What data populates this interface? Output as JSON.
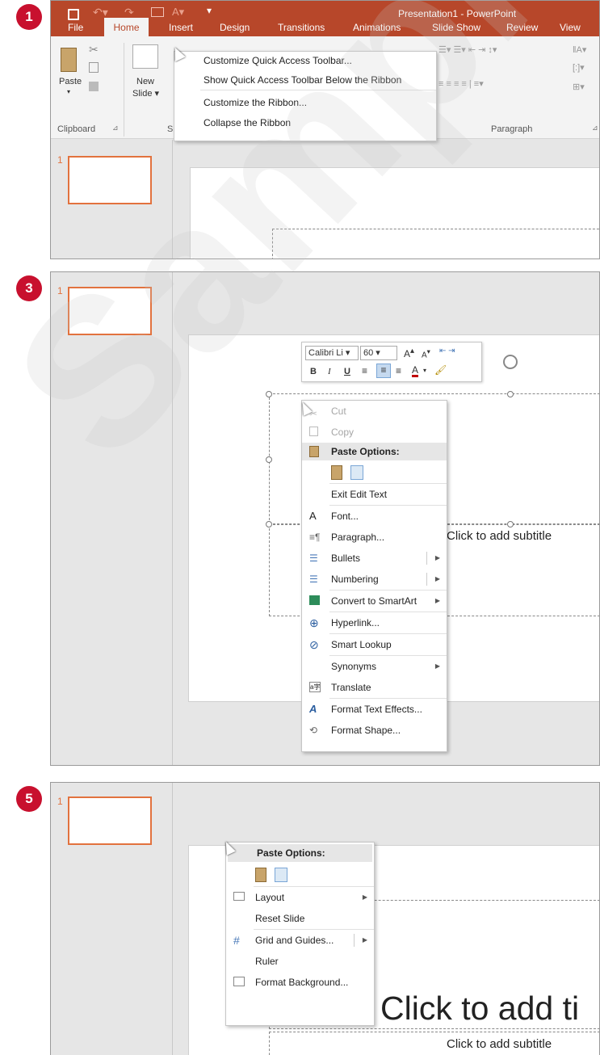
{
  "watermark": "Sample",
  "colors": {
    "accent": "#c8102e",
    "ppt": "#b7472a",
    "thumb_border": "#e2723e"
  },
  "badges": {
    "b1": "1",
    "b3": "3",
    "b5": "5"
  },
  "panel1": {
    "window_title": "Presentation1 - PowerPoint",
    "tabs": [
      "File",
      "Home",
      "Insert",
      "Design",
      "Transitions",
      "Animations",
      "Slide Show",
      "Review",
      "View"
    ],
    "active_tab": "Home",
    "clipboard": {
      "paste": "Paste",
      "group": "Clipboard"
    },
    "slides": {
      "new_slide": "New",
      "new_slide2": "Slide ▾",
      "group": "Sl"
    },
    "paragraph_group": "Paragraph",
    "qat_menu": [
      "Customize Quick Access Toolbar...",
      "Show Quick Access Toolbar Below the Ribbon",
      "Customize the Ribbon...",
      "Collapse the Ribbon"
    ],
    "slide_num": "1"
  },
  "panel3": {
    "slide_num": "1",
    "mini_toolbar": {
      "font": "Calibri Li",
      "size": "60",
      "bold": "B",
      "italic": "I",
      "underline": "U"
    },
    "subtitle": "Click to add subtitle",
    "context_menu": {
      "cut": "Cut",
      "copy": "Copy",
      "paste_options": "Paste Options:",
      "exit_edit": "Exit Edit Text",
      "font": "Font...",
      "paragraph": "Paragraph...",
      "bullets": "Bullets",
      "numbering": "Numbering",
      "smartart": "Convert to SmartArt",
      "hyperlink": "Hyperlink...",
      "smart_lookup": "Smart Lookup",
      "synonyms": "Synonyms",
      "translate": "Translate",
      "text_effects": "Format Text Effects...",
      "format_shape": "Format Shape..."
    }
  },
  "panel5": {
    "slide_num": "1",
    "title_placeholder": "Click to add ti",
    "subtitle": "Click to add subtitle",
    "context_menu": {
      "paste_options": "Paste Options:",
      "layout": "Layout",
      "reset_slide": "Reset Slide",
      "grid_guides": "Grid and Guides...",
      "ruler": "Ruler",
      "format_background": "Format Background..."
    }
  }
}
